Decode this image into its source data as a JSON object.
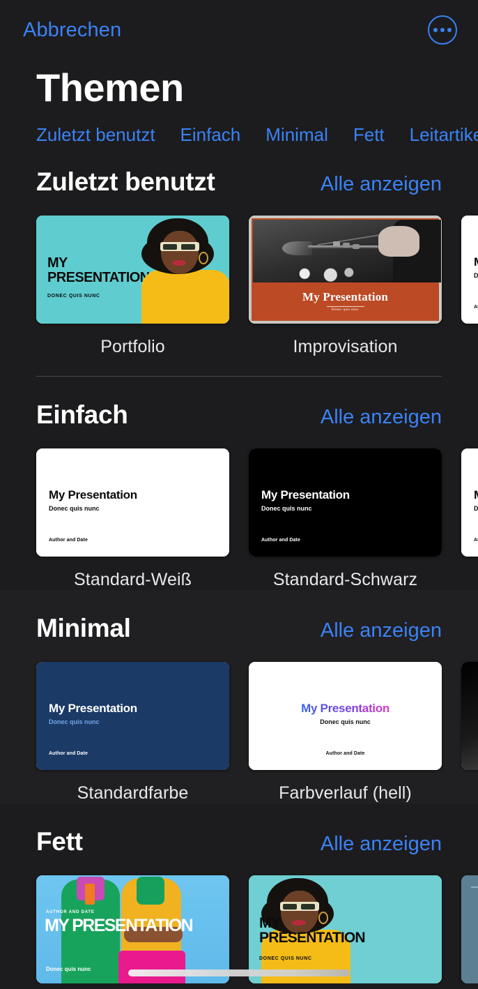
{
  "topbar": {
    "cancel_label": "Abbrechen",
    "more_icon": "ellipsis-circle-icon"
  },
  "page_title": "Themen",
  "accent_color": "#3b82f6",
  "background_color": "#1c1c1e",
  "tabs": [
    {
      "label": "Zuletzt benutzt"
    },
    {
      "label": "Einfach"
    },
    {
      "label": "Minimal"
    },
    {
      "label": "Fett"
    },
    {
      "label": "Leitartikel"
    }
  ],
  "see_all_label": "Alle anzeigen",
  "slide_text": {
    "title_upper_1": "MY",
    "title_upper_2": "PRESENTATION",
    "title_mixed": "My Presentation",
    "subtitle_upper": "DONEC QUIS NUNC",
    "subtitle_mixed": "Donec quis nunc",
    "author": "Author and Date",
    "author_upper": "AUTHOR AND DATE",
    "improv_title": "My Presentation",
    "improv_sub": "Donec quis nunc",
    "bold_title": "MY PRESENTATION"
  },
  "sections": [
    {
      "title": "Zuletzt benutzt",
      "see_all": "Alle anzeigen",
      "cards": [
        {
          "label": "Portfolio",
          "style": "portfolio"
        },
        {
          "label": "Improvisation",
          "style": "improvisation"
        },
        {
          "label": "",
          "style": "white-partial"
        }
      ]
    },
    {
      "title": "Einfach",
      "see_all": "Alle anzeigen",
      "cards": [
        {
          "label": "Standard-Weiß",
          "style": "white"
        },
        {
          "label": "Standard-Schwarz",
          "style": "black"
        },
        {
          "label": "",
          "style": "white-partial"
        }
      ]
    },
    {
      "title": "Minimal",
      "see_all": "Alle anzeigen",
      "cards": [
        {
          "label": "Standardfarbe",
          "style": "navy"
        },
        {
          "label": "Farbverlauf (hell)",
          "style": "gradient-light"
        },
        {
          "label": "",
          "style": "dark-gradient-partial"
        }
      ]
    },
    {
      "title": "Fett",
      "see_all": "Alle anzeigen",
      "cards": [
        {
          "label": "",
          "style": "bold-people"
        },
        {
          "label": "",
          "style": "bold-portfolio"
        },
        {
          "label": "",
          "style": "slate-partial"
        }
      ]
    }
  ]
}
